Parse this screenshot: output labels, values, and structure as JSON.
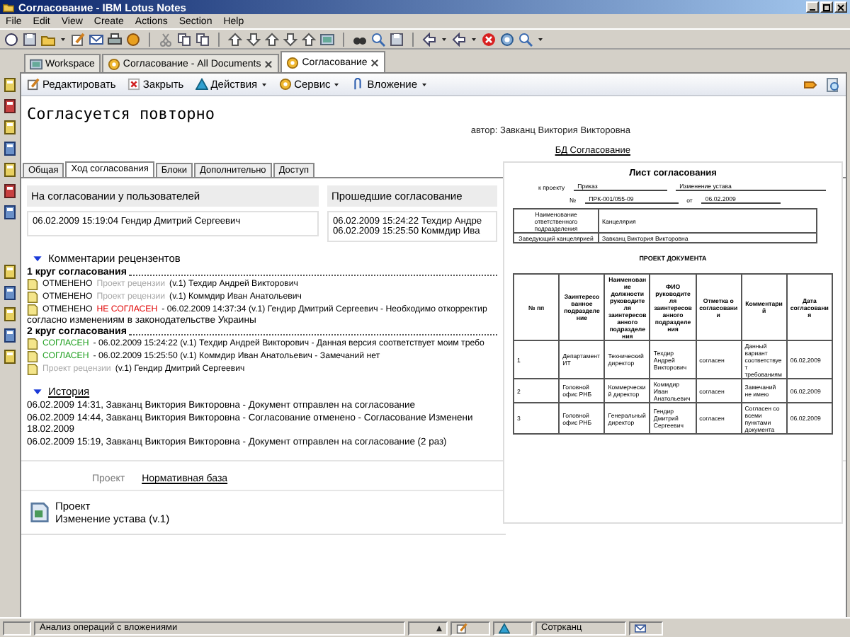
{
  "window": {
    "title": "Согласование - IBM Lotus Notes"
  },
  "menu": [
    "File",
    "Edit",
    "View",
    "Create",
    "Actions",
    "Section",
    "Help"
  ],
  "tabs": [
    {
      "label": "Workspace",
      "closable": false,
      "selected": false
    },
    {
      "label": "Согласование - All Documents",
      "closable": true,
      "selected": false
    },
    {
      "label": "Согласование",
      "closable": true,
      "selected": true
    }
  ],
  "actions": [
    {
      "label": "Редактировать",
      "dropdown": false
    },
    {
      "label": "Закрыть",
      "dropdown": false
    },
    {
      "label": "Действия",
      "dropdown": true
    },
    {
      "label": "Сервис",
      "dropdown": true
    },
    {
      "label": "Вложение",
      "dropdown": true
    }
  ],
  "document": {
    "title": "Согласуется повторно",
    "author": "автор: Завканц Виктория Викторовна",
    "database_link": "БД Согласование"
  },
  "doc_tabs": [
    {
      "label": "Общая",
      "selected": false
    },
    {
      "label": "Ход согласования",
      "selected": true
    },
    {
      "label": "Блоки",
      "selected": false
    },
    {
      "label": "Дополнительно",
      "selected": false
    },
    {
      "label": "Доступ",
      "selected": false
    }
  ],
  "pending": {
    "header": "На согласовании у пользователей",
    "entries": [
      "06.02.2009 15:19:04 Гендир Дмитрий Сергеевич"
    ]
  },
  "passed": {
    "header": "Прошедшие согласование",
    "entries": [
      "06.02.2009 15:24:22 Техдир Андре",
      "06.02.2009 15:25:50 Коммдир Ива"
    ]
  },
  "comments": {
    "title": "Комментарии рецензентов",
    "expanded": true,
    "rounds": [
      {
        "title": "1 круг согласования",
        "items": [
          {
            "segments": [
              {
                "text": "ОТМЕНЕНО",
                "color": "#000000"
              },
              {
                "text": "Проект рецензии",
                "color": "#a8a8a8"
              },
              {
                "text": "(v.1)  Техдир Андрей Викторович",
                "color": "#000000"
              }
            ]
          },
          {
            "segments": [
              {
                "text": "ОТМЕНЕНО",
                "color": "#000000"
              },
              {
                "text": "Проект рецензии",
                "color": "#a8a8a8"
              },
              {
                "text": "(v.1)  Коммдир Иван Анатольевич",
                "color": "#000000"
              }
            ]
          },
          {
            "segments": [
              {
                "text": "ОТМЕНЕНО",
                "color": "#000000"
              },
              {
                "text": "НЕ СОГЛАСЕН",
                "color": "#e00000"
              },
              {
                "text": "- 06.02.2009 14:37:34 (v.1)  Гендир Дмитрий Сергеевич - Необходимо откорректир",
                "color": "#000000"
              }
            ],
            "continuation": "согласно изменениям в законодательстве Украины"
          }
        ]
      },
      {
        "title": "2 круг согласования",
        "items": [
          {
            "segments": [
              {
                "text": "СОГЛАСЕН",
                "color": "#20a020"
              },
              {
                "text": "- 06.02.2009 15:24:22 (v.1)  Техдир Андрей Викторович - Данная версия соответствует моим требо",
                "color": "#000000"
              }
            ]
          },
          {
            "segments": [
              {
                "text": "СОГЛАСЕН",
                "color": "#20a020"
              },
              {
                "text": "- 06.02.2009 15:25:50 (v.1)  Коммдир Иван Анатольевич - Замечаний нет",
                "color": "#000000"
              }
            ]
          },
          {
            "segments": [
              {
                "text": "Проект рецензии",
                "color": "#a8a8a8"
              },
              {
                "text": "(v.1)  Гендир Дмитрий Сергеевич",
                "color": "#000000"
              }
            ]
          }
        ]
      }
    ]
  },
  "history": {
    "title": "История",
    "expanded": true,
    "lines": [
      "06.02.2009 14:31, Завканц Виктория Викторовна - Документ отправлен на согласование",
      "06.02.2009 14:44, Завканц Виктория Викторовна - Согласование отменено - Согласование Изменени",
      "18.02.2009",
      "06.02.2009 15:19, Завканц Виктория Викторовна - Документ отправлен на согласование (2 раз)"
    ]
  },
  "bottom_tabs": [
    {
      "label": "Проект",
      "selected": true
    },
    {
      "label": "Нормативная база",
      "selected": false
    }
  ],
  "attachment": {
    "title": "Проект",
    "name": "Изменение устава (v.1)"
  },
  "preview": {
    "title": "Лист согласования",
    "project_label": "к проекту",
    "project_type": "Приказ",
    "project_name": "Изменение устава",
    "number_label": "№",
    "number": "ПРК-001/055-09",
    "date_label": "от",
    "date": "06.02.2009",
    "info": [
      [
        "Наименование ответственного подразделения",
        "Канцелярия"
      ],
      [
        "Заведующий канцелярией",
        "Завканц Виктория Викторовна"
      ]
    ],
    "subtitle": "ПРОЕКТ ДОКУМЕНТА",
    "columns": [
      "№ пп",
      "Заинтересованное подразделение",
      "Наименование должности руководителя заинтересованного подразделения",
      "ФИО руководителя заинтересованного подразделения",
      "Отметка о согласовании",
      "Комментарий",
      "Дата согласования"
    ],
    "rows": [
      [
        "1",
        "Департамент ИТ",
        "Технический директор",
        "Техдир Андрей Викторович",
        "согласен",
        "Данный вариант соответствует требованиям",
        "06.02.2009"
      ],
      [
        "2",
        "Головной офис РНБ",
        "Коммерческий директор",
        "Коммдир Иван Анатольевич",
        "согласен",
        "Замечаний не имею",
        "06.02.2009"
      ],
      [
        "3",
        "Головной офис РНБ",
        "Генеральный директор",
        "Гендир Дмитрий Сергеевич",
        "согласен",
        "Согласен со всеми пунктами документа",
        "06.02.2009"
      ]
    ]
  },
  "status_bar": {
    "message": "Анализ операций с вложениями",
    "location": "Сотрканц"
  }
}
